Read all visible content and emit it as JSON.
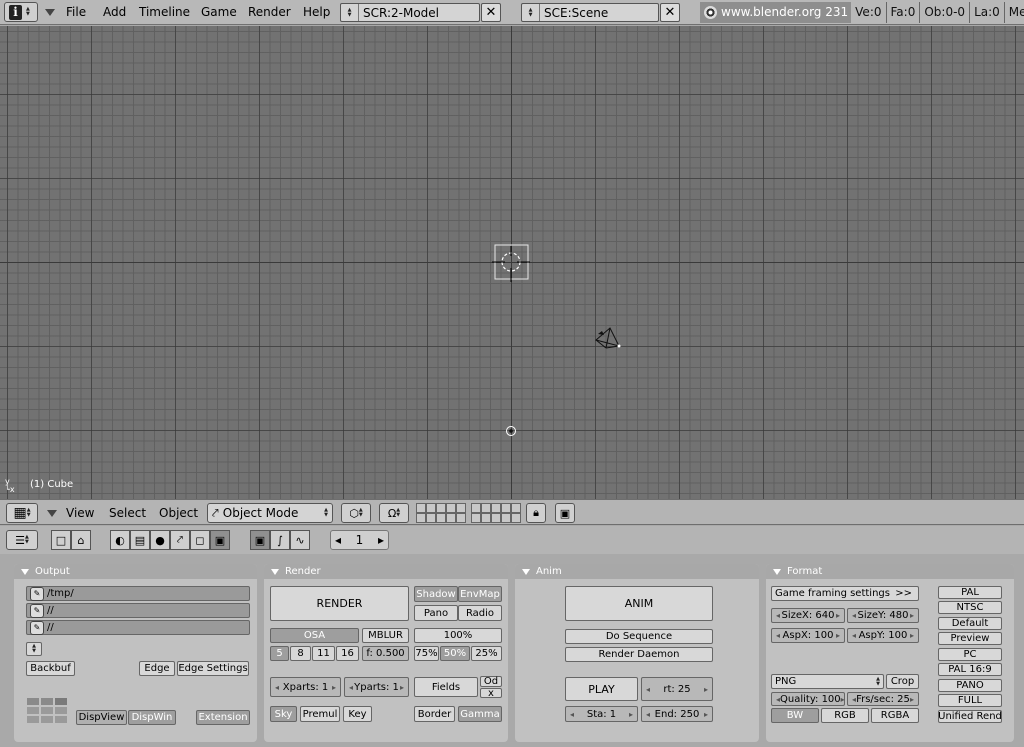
{
  "topbar": {
    "menus": [
      "File",
      "Add",
      "Timeline",
      "Game",
      "Render",
      "Help"
    ],
    "screen": "SCR:2-Model",
    "scene": "SCE:Scene",
    "url": "www.blender.org 231",
    "stats": [
      "Ve:0",
      "Fa:0",
      "Ob:0-0",
      "La:0",
      "Me"
    ]
  },
  "viewport": {
    "object_label": "(1) Cube",
    "axis_labels": {
      "y": "y",
      "x": "x"
    }
  },
  "view3d_header": {
    "menus": [
      "View",
      "Select",
      "Object"
    ],
    "mode": "Object Mode"
  },
  "buttons_header": {
    "frame": "1"
  },
  "output_panel": {
    "title": "Output",
    "paths": [
      "/tmp/",
      "//",
      "//"
    ],
    "backbuf": "Backbuf",
    "edge": "Edge",
    "edge_settings": "Edge Settings",
    "dispview": "DispView",
    "dispwin": "DispWin",
    "extension": "Extension"
  },
  "render_panel": {
    "title": "Render",
    "render": "RENDER",
    "shadow": "Shadow",
    "envmap": "EnvMap",
    "pano": "Pano",
    "radio": "Radio",
    "osa": "OSA",
    "mblur": "MBLUR",
    "percent100": "100%",
    "osa_levels": [
      "5",
      "8",
      "11",
      "16"
    ],
    "filter": "f: 0.500",
    "percent75": "75%",
    "percent50": "50%",
    "percent25": "25%",
    "xparts": "Xparts: 1",
    "yparts": "Yparts: 1",
    "fields": "Fields",
    "odd": "Od",
    "x": "x",
    "sky": "Sky",
    "premul": "Premul",
    "key": "Key",
    "border": "Border",
    "gamma": "Gamma"
  },
  "anim_panel": {
    "title": "Anim",
    "anim": "ANIM",
    "do_sequence": "Do Sequence",
    "render_daemon": "Render Daemon",
    "play": "PLAY",
    "rt": "rt: 25",
    "sta": "Sta: 1",
    "end": "End: 250"
  },
  "format_panel": {
    "title": "Format",
    "game_framing": "Game framing settings",
    "game_framing_arrow": ">>",
    "sizex": "SizeX: 640",
    "sizey": "SizeY: 480",
    "aspx": "AspX: 100",
    "aspy": "AspY: 100",
    "file_format": "PNG",
    "crop": "Crop",
    "quality": "Quality: 100",
    "fps": "Frs/sec: 25",
    "bw": "BW",
    "rgb": "RGB",
    "rgba": "RGBA",
    "presets": [
      "PAL",
      "NTSC",
      "Default",
      "Preview",
      "PC",
      "PAL 16:9",
      "PANO",
      "FULL",
      "Unified Rend"
    ]
  }
}
